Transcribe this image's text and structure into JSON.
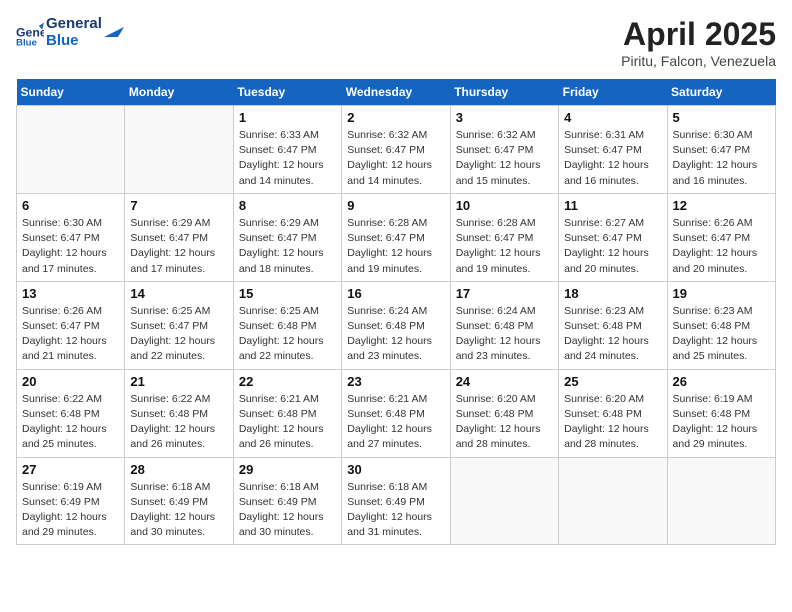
{
  "header": {
    "logo_line1": "General",
    "logo_line2": "Blue",
    "title": "April 2025",
    "subtitle": "Piritu, Falcon, Venezuela"
  },
  "weekdays": [
    "Sunday",
    "Monday",
    "Tuesday",
    "Wednesday",
    "Thursday",
    "Friday",
    "Saturday"
  ],
  "weeks": [
    [
      {
        "day": "",
        "info": ""
      },
      {
        "day": "",
        "info": ""
      },
      {
        "day": "1",
        "info": "Sunrise: 6:33 AM\nSunset: 6:47 PM\nDaylight: 12 hours and 14 minutes."
      },
      {
        "day": "2",
        "info": "Sunrise: 6:32 AM\nSunset: 6:47 PM\nDaylight: 12 hours and 14 minutes."
      },
      {
        "day": "3",
        "info": "Sunrise: 6:32 AM\nSunset: 6:47 PM\nDaylight: 12 hours and 15 minutes."
      },
      {
        "day": "4",
        "info": "Sunrise: 6:31 AM\nSunset: 6:47 PM\nDaylight: 12 hours and 16 minutes."
      },
      {
        "day": "5",
        "info": "Sunrise: 6:30 AM\nSunset: 6:47 PM\nDaylight: 12 hours and 16 minutes."
      }
    ],
    [
      {
        "day": "6",
        "info": "Sunrise: 6:30 AM\nSunset: 6:47 PM\nDaylight: 12 hours and 17 minutes."
      },
      {
        "day": "7",
        "info": "Sunrise: 6:29 AM\nSunset: 6:47 PM\nDaylight: 12 hours and 17 minutes."
      },
      {
        "day": "8",
        "info": "Sunrise: 6:29 AM\nSunset: 6:47 PM\nDaylight: 12 hours and 18 minutes."
      },
      {
        "day": "9",
        "info": "Sunrise: 6:28 AM\nSunset: 6:47 PM\nDaylight: 12 hours and 19 minutes."
      },
      {
        "day": "10",
        "info": "Sunrise: 6:28 AM\nSunset: 6:47 PM\nDaylight: 12 hours and 19 minutes."
      },
      {
        "day": "11",
        "info": "Sunrise: 6:27 AM\nSunset: 6:47 PM\nDaylight: 12 hours and 20 minutes."
      },
      {
        "day": "12",
        "info": "Sunrise: 6:26 AM\nSunset: 6:47 PM\nDaylight: 12 hours and 20 minutes."
      }
    ],
    [
      {
        "day": "13",
        "info": "Sunrise: 6:26 AM\nSunset: 6:47 PM\nDaylight: 12 hours and 21 minutes."
      },
      {
        "day": "14",
        "info": "Sunrise: 6:25 AM\nSunset: 6:47 PM\nDaylight: 12 hours and 22 minutes."
      },
      {
        "day": "15",
        "info": "Sunrise: 6:25 AM\nSunset: 6:48 PM\nDaylight: 12 hours and 22 minutes."
      },
      {
        "day": "16",
        "info": "Sunrise: 6:24 AM\nSunset: 6:48 PM\nDaylight: 12 hours and 23 minutes."
      },
      {
        "day": "17",
        "info": "Sunrise: 6:24 AM\nSunset: 6:48 PM\nDaylight: 12 hours and 23 minutes."
      },
      {
        "day": "18",
        "info": "Sunrise: 6:23 AM\nSunset: 6:48 PM\nDaylight: 12 hours and 24 minutes."
      },
      {
        "day": "19",
        "info": "Sunrise: 6:23 AM\nSunset: 6:48 PM\nDaylight: 12 hours and 25 minutes."
      }
    ],
    [
      {
        "day": "20",
        "info": "Sunrise: 6:22 AM\nSunset: 6:48 PM\nDaylight: 12 hours and 25 minutes."
      },
      {
        "day": "21",
        "info": "Sunrise: 6:22 AM\nSunset: 6:48 PM\nDaylight: 12 hours and 26 minutes."
      },
      {
        "day": "22",
        "info": "Sunrise: 6:21 AM\nSunset: 6:48 PM\nDaylight: 12 hours and 26 minutes."
      },
      {
        "day": "23",
        "info": "Sunrise: 6:21 AM\nSunset: 6:48 PM\nDaylight: 12 hours and 27 minutes."
      },
      {
        "day": "24",
        "info": "Sunrise: 6:20 AM\nSunset: 6:48 PM\nDaylight: 12 hours and 28 minutes."
      },
      {
        "day": "25",
        "info": "Sunrise: 6:20 AM\nSunset: 6:48 PM\nDaylight: 12 hours and 28 minutes."
      },
      {
        "day": "26",
        "info": "Sunrise: 6:19 AM\nSunset: 6:48 PM\nDaylight: 12 hours and 29 minutes."
      }
    ],
    [
      {
        "day": "27",
        "info": "Sunrise: 6:19 AM\nSunset: 6:49 PM\nDaylight: 12 hours and 29 minutes."
      },
      {
        "day": "28",
        "info": "Sunrise: 6:18 AM\nSunset: 6:49 PM\nDaylight: 12 hours and 30 minutes."
      },
      {
        "day": "29",
        "info": "Sunrise: 6:18 AM\nSunset: 6:49 PM\nDaylight: 12 hours and 30 minutes."
      },
      {
        "day": "30",
        "info": "Sunrise: 6:18 AM\nSunset: 6:49 PM\nDaylight: 12 hours and 31 minutes."
      },
      {
        "day": "",
        "info": ""
      },
      {
        "day": "",
        "info": ""
      },
      {
        "day": "",
        "info": ""
      }
    ]
  ]
}
